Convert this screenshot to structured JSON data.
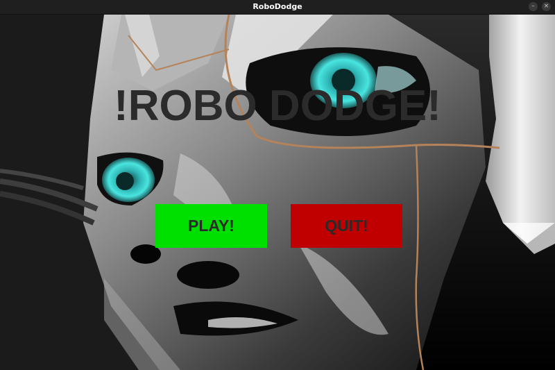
{
  "window": {
    "title": "RoboDodge",
    "minimize_glyph": "–",
    "close_glyph": "×"
  },
  "game": {
    "title": "!ROBO DODGE!",
    "title_color": "#2b2b2b"
  },
  "buttons": {
    "play": {
      "label": "PLAY!",
      "color": "#00e000"
    },
    "quit": {
      "label": "QUIT!",
      "color": "#c00000"
    }
  },
  "icons": {
    "minimize": "minimize-icon",
    "close": "close-icon"
  }
}
